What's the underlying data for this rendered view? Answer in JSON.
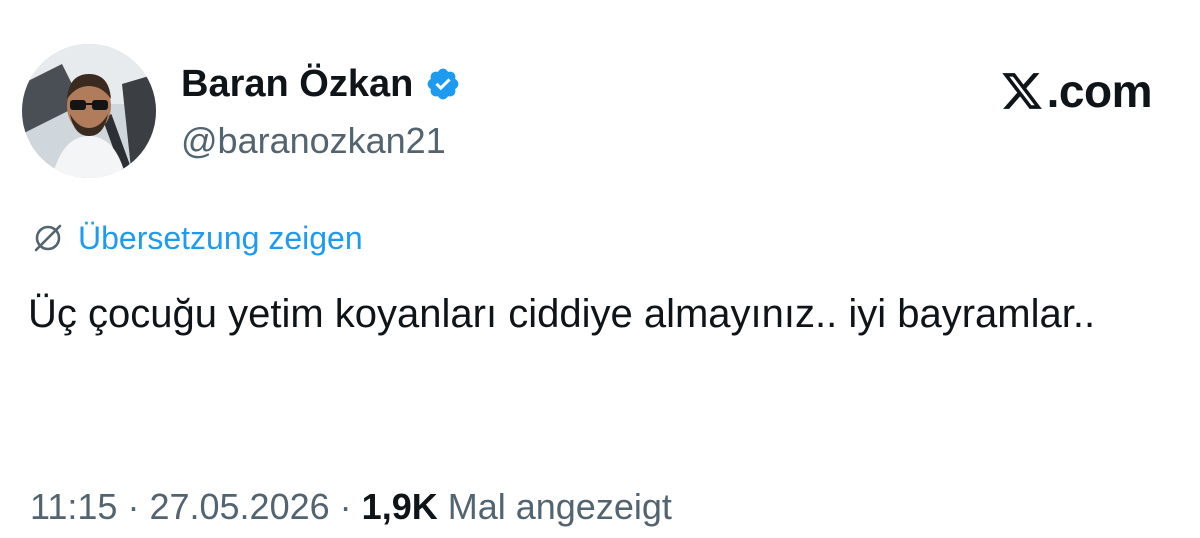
{
  "author": {
    "display_name": "Baran Özkan",
    "handle": "@baranozkan21",
    "verified": true,
    "verified_color": "#1d9bf0"
  },
  "brand": {
    "text": ".com",
    "icon": "x-logo-icon"
  },
  "translate": {
    "label": "Übersetzung zeigen",
    "icon": "translate-globe-icon",
    "color": "#1d9bf0"
  },
  "tweet": {
    "text": "Üç çocuğu yetim koyanları ciddiye almayınız.. iyi bayramlar.."
  },
  "meta": {
    "time": "11:15",
    "separator": "·",
    "date": "27.05.2026",
    "views_count": "1,9K",
    "views_label": "Mal angezeigt"
  },
  "colors": {
    "text_primary": "#0f1419",
    "text_secondary": "#536471",
    "accent": "#1d9bf0"
  }
}
